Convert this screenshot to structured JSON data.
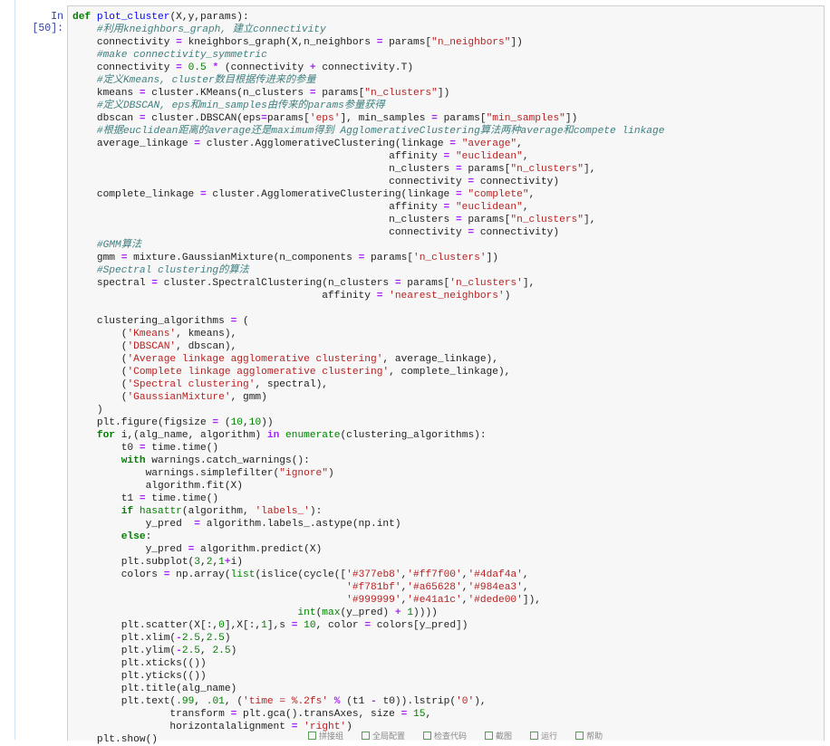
{
  "cell": {
    "prompt": "In [50]:",
    "lines": [
      [
        [
          "kw",
          "def "
        ],
        [
          "fn",
          "plot_cluster"
        ],
        [
          "t",
          "(X,y,params):"
        ]
      ],
      [
        [
          "t",
          "    "
        ],
        [
          "cm",
          "#利用kneighbors_graph, 建立connectivity"
        ]
      ],
      [
        [
          "t",
          "    connectivity "
        ],
        [
          "op",
          "="
        ],
        [
          "t",
          " kneighbors_graph(X,n_neighbors "
        ],
        [
          "op",
          "="
        ],
        [
          "t",
          " params["
        ],
        [
          "str",
          "\"n_neighbors\""
        ],
        [
          "t",
          "])"
        ]
      ],
      [
        [
          "t",
          "    "
        ],
        [
          "cm",
          "#make connectivity_symmetric"
        ]
      ],
      [
        [
          "t",
          "    connectivity "
        ],
        [
          "op",
          "="
        ],
        [
          "t",
          " "
        ],
        [
          "num",
          "0.5"
        ],
        [
          "t",
          " "
        ],
        [
          "op",
          "*"
        ],
        [
          "t",
          " (connectivity "
        ],
        [
          "op",
          "+"
        ],
        [
          "t",
          " connectivity.T)"
        ]
      ],
      [
        [
          "t",
          "    "
        ],
        [
          "cm",
          "#定义Kmeans, cluster数目根据传进来的参量"
        ]
      ],
      [
        [
          "t",
          "    kmeans "
        ],
        [
          "op",
          "="
        ],
        [
          "t",
          " cluster.KMeans(n_clusters "
        ],
        [
          "op",
          "="
        ],
        [
          "t",
          " params["
        ],
        [
          "str",
          "\"n_clusters\""
        ],
        [
          "t",
          "])"
        ]
      ],
      [
        [
          "t",
          "    "
        ],
        [
          "cm",
          "#定义DBSCAN, eps和min_samples由传来的params参量获得"
        ]
      ],
      [
        [
          "t",
          "    dbscan "
        ],
        [
          "op",
          "="
        ],
        [
          "t",
          " cluster.DBSCAN(eps"
        ],
        [
          "op",
          "="
        ],
        [
          "t",
          "params["
        ],
        [
          "str",
          "'eps'"
        ],
        [
          "t",
          "], min_samples "
        ],
        [
          "op",
          "="
        ],
        [
          "t",
          " params["
        ],
        [
          "str",
          "\"min_samples\""
        ],
        [
          "t",
          "])"
        ]
      ],
      [
        [
          "t",
          "    "
        ],
        [
          "cm",
          "#根据euclidean距离的average还是maximum得到 AgglomerativeClustering算法两种average和compete linkage"
        ]
      ],
      [
        [
          "t",
          "    average_linkage "
        ],
        [
          "op",
          "="
        ],
        [
          "t",
          " cluster.AgglomerativeClustering(linkage "
        ],
        [
          "op",
          "="
        ],
        [
          "t",
          " "
        ],
        [
          "str",
          "\"average\""
        ],
        [
          "t",
          ","
        ]
      ],
      [
        [
          "t",
          "                                                    affinity "
        ],
        [
          "op",
          "="
        ],
        [
          "t",
          " "
        ],
        [
          "str",
          "\"euclidean\""
        ],
        [
          "t",
          ","
        ]
      ],
      [
        [
          "t",
          "                                                    n_clusters "
        ],
        [
          "op",
          "="
        ],
        [
          "t",
          " params["
        ],
        [
          "str",
          "\"n_clusters\""
        ],
        [
          "t",
          "],"
        ]
      ],
      [
        [
          "t",
          "                                                    connectivity "
        ],
        [
          "op",
          "="
        ],
        [
          "t",
          " connectivity)"
        ]
      ],
      [
        [
          "t",
          "    complete_linkage "
        ],
        [
          "op",
          "="
        ],
        [
          "t",
          " cluster.AgglomerativeClustering(linkage "
        ],
        [
          "op",
          "="
        ],
        [
          "t",
          " "
        ],
        [
          "str",
          "\"complete\""
        ],
        [
          "t",
          ","
        ]
      ],
      [
        [
          "t",
          "                                                    affinity "
        ],
        [
          "op",
          "="
        ],
        [
          "t",
          " "
        ],
        [
          "str",
          "\"euclidean\""
        ],
        [
          "t",
          ","
        ]
      ],
      [
        [
          "t",
          "                                                    n_clusters "
        ],
        [
          "op",
          "="
        ],
        [
          "t",
          " params["
        ],
        [
          "str",
          "\"n_clusters\""
        ],
        [
          "t",
          "],"
        ]
      ],
      [
        [
          "t",
          "                                                    connectivity "
        ],
        [
          "op",
          "="
        ],
        [
          "t",
          " connectivity)"
        ]
      ],
      [
        [
          "t",
          "    "
        ],
        [
          "cm",
          "#GMM算法"
        ]
      ],
      [
        [
          "t",
          "    gmm "
        ],
        [
          "op",
          "="
        ],
        [
          "t",
          " mixture.GaussianMixture(n_components "
        ],
        [
          "op",
          "="
        ],
        [
          "t",
          " params["
        ],
        [
          "str",
          "'n_clusters'"
        ],
        [
          "t",
          "])"
        ]
      ],
      [
        [
          "t",
          "    "
        ],
        [
          "cm",
          "#Spectral clustering的算法"
        ]
      ],
      [
        [
          "t",
          "    spectral "
        ],
        [
          "op",
          "="
        ],
        [
          "t",
          " cluster.SpectralClustering(n_clusters "
        ],
        [
          "op",
          "="
        ],
        [
          "t",
          " params["
        ],
        [
          "str",
          "'n_clusters'"
        ],
        [
          "t",
          "],"
        ]
      ],
      [
        [
          "t",
          "                                         affinity "
        ],
        [
          "op",
          "="
        ],
        [
          "t",
          " "
        ],
        [
          "str",
          "'nearest_neighbors'"
        ],
        [
          "t",
          ")"
        ]
      ],
      [
        [
          "t",
          ""
        ]
      ],
      [
        [
          "t",
          "    clustering_algorithms "
        ],
        [
          "op",
          "="
        ],
        [
          "t",
          " ("
        ]
      ],
      [
        [
          "t",
          "        ("
        ],
        [
          "str",
          "'Kmeans'"
        ],
        [
          "t",
          ", kmeans),"
        ]
      ],
      [
        [
          "t",
          "        ("
        ],
        [
          "str",
          "'DBSCAN'"
        ],
        [
          "t",
          ", dbscan),"
        ]
      ],
      [
        [
          "t",
          "        ("
        ],
        [
          "str",
          "'Average linkage agglomerative clustering'"
        ],
        [
          "t",
          ", average_linkage),"
        ]
      ],
      [
        [
          "t",
          "        ("
        ],
        [
          "str",
          "'Complete linkage agglomerative clustering'"
        ],
        [
          "t",
          ", complete_linkage),"
        ]
      ],
      [
        [
          "t",
          "        ("
        ],
        [
          "str",
          "'Spectral clustering'"
        ],
        [
          "t",
          ", spectral),"
        ]
      ],
      [
        [
          "t",
          "        ("
        ],
        [
          "str",
          "'GaussianMixture'"
        ],
        [
          "t",
          ", gmm)"
        ]
      ],
      [
        [
          "t",
          "    )"
        ]
      ],
      [
        [
          "t",
          "    plt.figure(figsize "
        ],
        [
          "op",
          "="
        ],
        [
          "t",
          " ("
        ],
        [
          "num",
          "10"
        ],
        [
          "t",
          ","
        ],
        [
          "num",
          "10"
        ],
        [
          "t",
          "))"
        ]
      ],
      [
        [
          "t",
          "    "
        ],
        [
          "kw",
          "for"
        ],
        [
          "t",
          " i,(alg_name, algorithm) "
        ],
        [
          "op",
          "in"
        ],
        [
          "t",
          " "
        ],
        [
          "bi",
          "enumerate"
        ],
        [
          "t",
          "(clustering_algorithms):"
        ]
      ],
      [
        [
          "t",
          "        t0 "
        ],
        [
          "op",
          "="
        ],
        [
          "t",
          " time.time()"
        ]
      ],
      [
        [
          "t",
          "        "
        ],
        [
          "kw",
          "with"
        ],
        [
          "t",
          " warnings.catch_warnings():"
        ]
      ],
      [
        [
          "t",
          "            warnings.simplefilter("
        ],
        [
          "str",
          "\"ignore\""
        ],
        [
          "t",
          ")"
        ]
      ],
      [
        [
          "t",
          "            algorithm.fit(X)"
        ]
      ],
      [
        [
          "t",
          "        t1 "
        ],
        [
          "op",
          "="
        ],
        [
          "t",
          " time.time()"
        ]
      ],
      [
        [
          "t",
          "        "
        ],
        [
          "kw",
          "if"
        ],
        [
          "t",
          " "
        ],
        [
          "bi",
          "hasattr"
        ],
        [
          "t",
          "(algorithm, "
        ],
        [
          "str",
          "'labels_'"
        ],
        [
          "t",
          "):"
        ]
      ],
      [
        [
          "t",
          "            y_pred  "
        ],
        [
          "op",
          "="
        ],
        [
          "t",
          " algorithm.labels_.astype(np.int)"
        ]
      ],
      [
        [
          "t",
          "        "
        ],
        [
          "kw",
          "else"
        ],
        [
          "t",
          ":"
        ]
      ],
      [
        [
          "t",
          "            y_pred "
        ],
        [
          "op",
          "="
        ],
        [
          "t",
          " algorithm.predict(X)"
        ]
      ],
      [
        [
          "t",
          "        plt.subplot("
        ],
        [
          "num",
          "3"
        ],
        [
          "t",
          ","
        ],
        [
          "num",
          "2"
        ],
        [
          "t",
          ","
        ],
        [
          "num",
          "1"
        ],
        [
          "op",
          "+"
        ],
        [
          "t",
          "i)"
        ]
      ],
      [
        [
          "t",
          "        colors "
        ],
        [
          "op",
          "="
        ],
        [
          "t",
          " np.array("
        ],
        [
          "bi",
          "list"
        ],
        [
          "t",
          "(islice(cycle(["
        ],
        [
          "str",
          "'#377eb8'"
        ],
        [
          "t",
          ","
        ],
        [
          "str",
          "'#ff7f00'"
        ],
        [
          "t",
          ","
        ],
        [
          "str",
          "'#4daf4a'"
        ],
        [
          "t",
          ","
        ]
      ],
      [
        [
          "t",
          "                                             "
        ],
        [
          "str",
          "'#f781bf'"
        ],
        [
          "t",
          ","
        ],
        [
          "str",
          "'#a65628'"
        ],
        [
          "t",
          ","
        ],
        [
          "str",
          "'#984ea3'"
        ],
        [
          "t",
          ","
        ]
      ],
      [
        [
          "t",
          "                                             "
        ],
        [
          "str",
          "'#999999'"
        ],
        [
          "t",
          ","
        ],
        [
          "str",
          "'#e41a1c'"
        ],
        [
          "t",
          ","
        ],
        [
          "str",
          "'#dede00'"
        ],
        [
          "t",
          "]),"
        ]
      ],
      [
        [
          "t",
          "                                     "
        ],
        [
          "bi",
          "int"
        ],
        [
          "t",
          "("
        ],
        [
          "bi",
          "max"
        ],
        [
          "t",
          "(y_pred) "
        ],
        [
          "op",
          "+"
        ],
        [
          "t",
          " "
        ],
        [
          "num",
          "1"
        ],
        [
          "t",
          "))))"
        ]
      ],
      [
        [
          "t",
          "        plt.scatter(X[:,"
        ],
        [
          "num",
          "0"
        ],
        [
          "t",
          "],X[:,"
        ],
        [
          "num",
          "1"
        ],
        [
          "t",
          "],s "
        ],
        [
          "op",
          "="
        ],
        [
          "t",
          " "
        ],
        [
          "num",
          "10"
        ],
        [
          "t",
          ", color "
        ],
        [
          "op",
          "="
        ],
        [
          "t",
          " colors[y_pred])"
        ]
      ],
      [
        [
          "t",
          "        plt.xlim("
        ],
        [
          "op",
          "-"
        ],
        [
          "num",
          "2.5"
        ],
        [
          "t",
          ","
        ],
        [
          "num",
          "2.5"
        ],
        [
          "t",
          ")"
        ]
      ],
      [
        [
          "t",
          "        plt.ylim("
        ],
        [
          "op",
          "-"
        ],
        [
          "num",
          "2.5"
        ],
        [
          "t",
          ", "
        ],
        [
          "num",
          "2.5"
        ],
        [
          "t",
          ")"
        ]
      ],
      [
        [
          "t",
          "        plt.xticks(())"
        ]
      ],
      [
        [
          "t",
          "        plt.yticks(())"
        ]
      ],
      [
        [
          "t",
          "        plt.title(alg_name)"
        ]
      ],
      [
        [
          "t",
          "        plt.text("
        ],
        [
          "num",
          ".99"
        ],
        [
          "t",
          ", "
        ],
        [
          "num",
          ".01"
        ],
        [
          "t",
          ", ("
        ],
        [
          "str",
          "'time = %.2fs'"
        ],
        [
          "t",
          " "
        ],
        [
          "op",
          "%"
        ],
        [
          "t",
          " (t1 "
        ],
        [
          "op",
          "-"
        ],
        [
          "t",
          " t0)).lstrip("
        ],
        [
          "str",
          "'0'"
        ],
        [
          "t",
          "),"
        ]
      ],
      [
        [
          "t",
          "                transform "
        ],
        [
          "op",
          "="
        ],
        [
          "t",
          " plt.gca().transAxes, size "
        ],
        [
          "op",
          "="
        ],
        [
          "t",
          " "
        ],
        [
          "num",
          "15"
        ],
        [
          "t",
          ","
        ]
      ],
      [
        [
          "t",
          "                horizontalalignment "
        ],
        [
          "op",
          "="
        ],
        [
          "t",
          " "
        ],
        [
          "str",
          "'right'"
        ],
        [
          "t",
          ")"
        ]
      ],
      [
        [
          "t",
          "    plt.show()"
        ]
      ]
    ]
  },
  "colors": {
    "keyword": "#008000",
    "string": "#ba2121",
    "comment": "#408080",
    "operator": "#aa22ff",
    "function": "#0000ff",
    "prompt": "#303f9f",
    "cell_border": "#cfcfcf",
    "cell_background": "#f7f7f7"
  },
  "statusbar": {
    "items": [
      "拼接组",
      "全局配置",
      "检查代码",
      "截图",
      "运行",
      "帮助"
    ]
  }
}
